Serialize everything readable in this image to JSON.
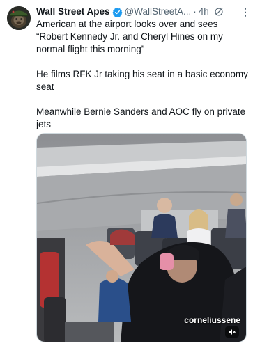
{
  "tweet": {
    "author_name": "Wall Street Apes",
    "handle": "@WallStreetA...",
    "separator": "·",
    "time": "4h",
    "more_label": "⋮",
    "paragraphs": [
      "American at the airport looks over and sees “Robert Kennedy Jr. and Cheryl Hines on my normal flight this morning”",
      "He films RFK Jr taking his seat in a basic economy seat",
      "Meanwhile Bernie Sanders and AOC fly on private jets"
    ]
  },
  "media": {
    "watermark": "corneliussene",
    "icons": [
      "mute-icon"
    ]
  },
  "colors": {
    "text_primary": "#0f1419",
    "text_secondary": "#536471",
    "verified_blue": "#1d9bf0",
    "border": "#cfd9de"
  }
}
